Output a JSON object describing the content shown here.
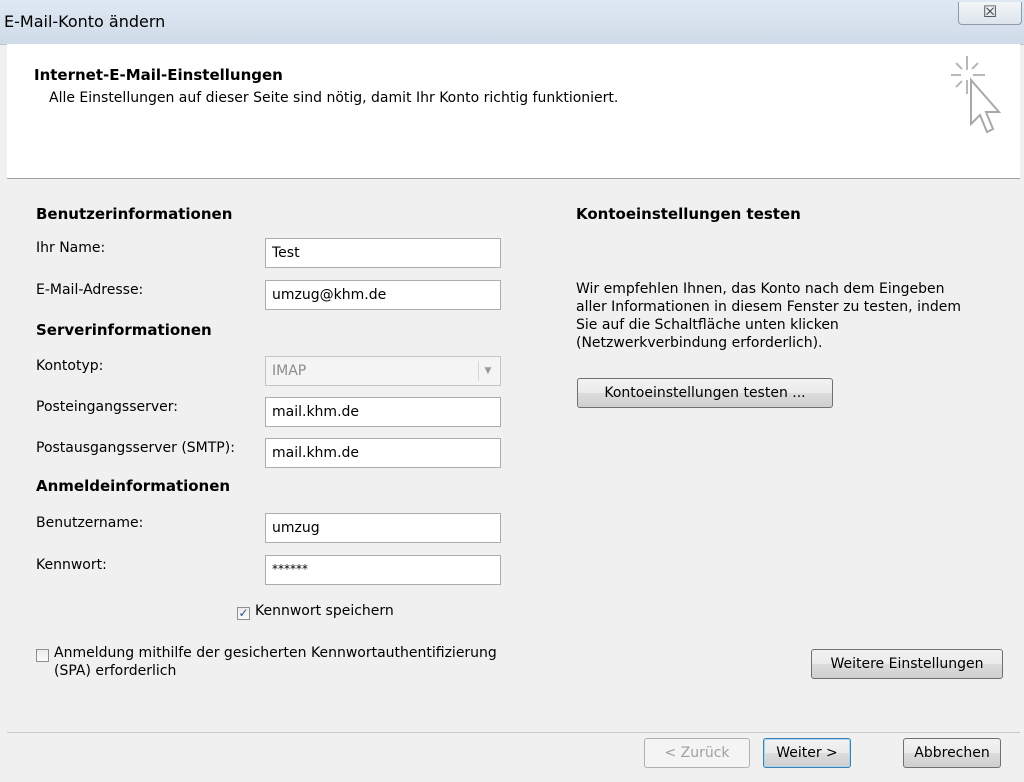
{
  "window": {
    "title": "E-Mail-Konto ändern",
    "close_symbol": "☒"
  },
  "header": {
    "title": "Internet-E-Mail-Einstellungen",
    "subtitle": "Alle Einstellungen auf dieser Seite sind nötig, damit Ihr Konto richtig funktioniert.",
    "icon": "wizard-cursor-icon"
  },
  "user_info": {
    "section_title": "Benutzerinformationen",
    "name_label": "Ihr Name:",
    "name_value": "Test",
    "email_label": "E-Mail-Adresse:",
    "email_value": "umzug@khm.de"
  },
  "server_info": {
    "section_title": "Serverinformationen",
    "account_type_label": "Kontotyp:",
    "account_type_value": "IMAP",
    "incoming_label": "Posteingangsserver:",
    "incoming_value": "mail.khm.de",
    "outgoing_label": "Postausgangsserver (SMTP):",
    "outgoing_value": "mail.khm.de"
  },
  "login_info": {
    "section_title": "Anmeldeinformationen",
    "username_label": "Benutzername:",
    "username_value": "umzug",
    "password_label": "Kennwort:",
    "password_value": "******",
    "remember_label": "Kennwort speichern",
    "remember_checked": true,
    "spa_label_line1": "Anmeldung mithilfe der gesicherten Kennwortauthentifizierung",
    "spa_label_line2": "(SPA) erforderlich",
    "spa_checked": false
  },
  "test_settings": {
    "section_title": "Kontoeinstellungen testen",
    "description_lines": [
      "Wir empfehlen Ihnen, das Konto nach dem Eingeben",
      "aller Informationen in diesem Fenster zu testen, indem",
      "Sie auf die Schaltfläche unten klicken",
      "(Netzwerkverbindung erforderlich)."
    ],
    "test_button": "Kontoeinstellungen testen ..."
  },
  "more_settings_button": "Weitere Einstellungen",
  "footer": {
    "back_button": "< Zurück",
    "next_button": "Weiter >",
    "cancel_button": "Abbrechen"
  },
  "colors": {
    "header_bg": "#ffffff",
    "dialog_bg": "#f0f0f0",
    "checkmark": "#2a4b8d"
  }
}
